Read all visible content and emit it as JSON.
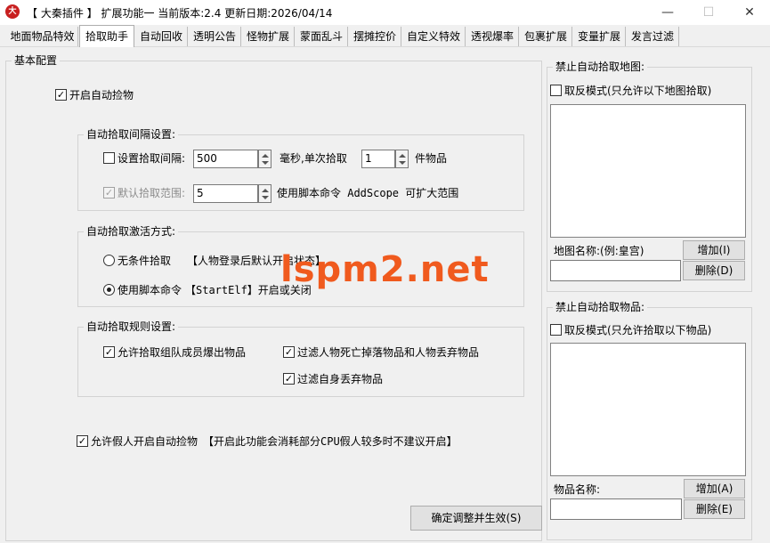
{
  "window": {
    "title": "【 大秦插件 】 扩展功能一 当前版本:2.4 更新日期:2026/04/14",
    "app_icon": "大",
    "min_glyph": "—",
    "max_glyph": "☐",
    "close_glyph": "✕"
  },
  "tabs": [
    {
      "label": "地面物品特效"
    },
    {
      "label": "拾取助手"
    },
    {
      "label": "自动回收"
    },
    {
      "label": "透明公告"
    },
    {
      "label": "怪物扩展"
    },
    {
      "label": "蒙面乱斗"
    },
    {
      "label": "摆摊控价"
    },
    {
      "label": "自定义特效"
    },
    {
      "label": "透视爆率"
    },
    {
      "label": "包裹扩展"
    },
    {
      "label": "变量扩展"
    },
    {
      "label": "发言过滤"
    }
  ],
  "basic": {
    "title": "基本配置",
    "enable_auto_pick": {
      "label": "开启自动捡物",
      "checked": true
    },
    "interval_group": {
      "title": "自动拾取间隔设置:",
      "set_interval": {
        "label": "设置拾取间隔:",
        "checked": false
      },
      "interval_value": "500",
      "ms_label": "毫秒,单次拾取",
      "count_value": "1",
      "items_label": "件物品",
      "default_range": {
        "label": "默认拾取范围:",
        "checked": true
      },
      "range_value": "5",
      "range_hint": "使用脚本命令 AddScope 可扩大范围"
    },
    "activation_group": {
      "title": "自动拾取激活方式:",
      "unconditional": {
        "label": "无条件拾取",
        "selected": false
      },
      "unconditional_hint": "【人物登录后默认开启状态】",
      "script_cmd": {
        "label": "使用脚本命令",
        "selected": true
      },
      "script_cmd_hint": "【StartElf】开启或关闭"
    },
    "rules_group": {
      "title": "自动拾取规则设置:",
      "allow_team": {
        "label": "允许拾取组队成员爆出物品",
        "checked": true
      },
      "filter_death": {
        "label": "过滤人物死亡掉落物品和人物丢弃物品",
        "checked": true
      },
      "filter_self": {
        "label": "过滤自身丢弃物品",
        "checked": true
      }
    },
    "allow_fake": {
      "label": "允许假人开启自动捡物",
      "checked": true
    },
    "allow_fake_hint": "【开启此功能会消耗部分CPU假人较多时不建议开启】",
    "confirm_button": "确定调整并生效(S)"
  },
  "ban_maps": {
    "title": "禁止自动拾取地图:",
    "invert": {
      "label": "取反模式(只允许以下地图拾取)",
      "checked": false
    },
    "name_label": "地图名称:(例:皇宫)",
    "name_value": "",
    "add_button": "增加(I)",
    "delete_button": "删除(D)"
  },
  "ban_items": {
    "title": "禁止自动拾取物品:",
    "invert": {
      "label": "取反模式(只允许拾取以下物品)",
      "checked": false
    },
    "name_label": "物品名称:",
    "name_value": "",
    "add_button": "增加(A)",
    "delete_button": "删除(E)"
  },
  "watermark": "lspm2.net",
  "check_glyph": "✓"
}
